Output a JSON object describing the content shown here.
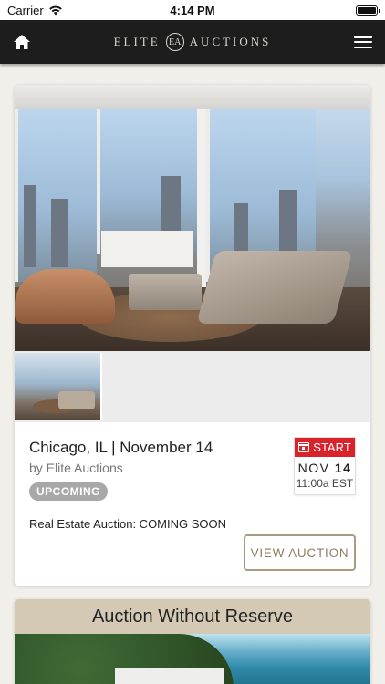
{
  "status_bar": {
    "carrier": "Carrier",
    "time": "4:14 PM",
    "battery_level": 1.0
  },
  "nav": {
    "logo_text": "ELITE AUCTIONS",
    "logo_mark": "EA",
    "home_icon": "home-icon",
    "menu_icon": "hamburger-menu-icon"
  },
  "listing": {
    "title": "Chicago, IL | November 14",
    "byline": "by Elite Auctions",
    "status": "UPCOMING",
    "description": "Real Estate Auction: COMING SOON",
    "date_label": "START",
    "date_month": "NOV",
    "date_day": "14",
    "date_time": "11:00a EST",
    "cta": "VIEW AUCTION",
    "accent_color": "#d8232a",
    "button_color": "#a99b7f"
  },
  "listing2": {
    "title": "Auction Without Reserve"
  }
}
